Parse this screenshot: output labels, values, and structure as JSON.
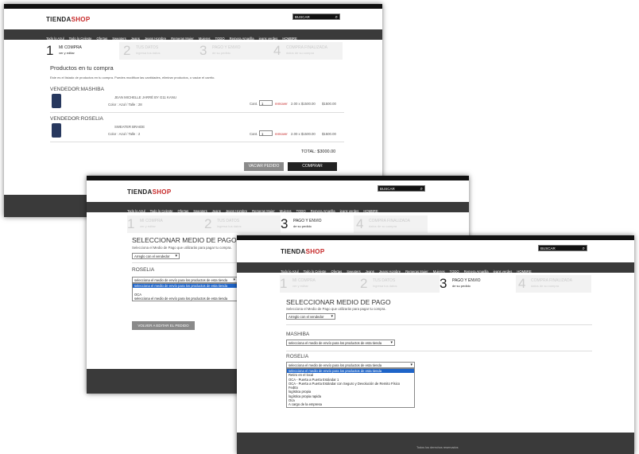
{
  "brand": {
    "name_a": "TIENDA",
    "name_b": "SHOP"
  },
  "search": {
    "label": "BUSCAR"
  },
  "nav": [
    "Todo lo Azul",
    "Todo lo Celeste",
    "Ofertas",
    "Sweaters",
    "Jeans",
    "Jeans Hombre",
    "Remeras Mujer",
    "Mujeres",
    "TODO",
    "Remera Amarilla",
    "jeans verdes",
    "HOMBRE"
  ],
  "steps": [
    {
      "num": "1",
      "title": "MI COMPRA",
      "sub": "ver y editar"
    },
    {
      "num": "2",
      "title": "TUS DATOS",
      "sub": "ingresa tus datos"
    },
    {
      "num": "3",
      "title": "PAGO Y ENVIO",
      "sub": "de su pedido"
    },
    {
      "num": "4",
      "title": "COMPRA FINALIZADA",
      "sub": "datos de su compra"
    }
  ],
  "cart": {
    "heading": "Productos en tu compra",
    "intro": "Este es el listado de productos en tu compra. Puedes modificar las cantidades, eliminar productos, o vaciar el carrito.",
    "vendors": [
      {
        "label": "VENDEDOR:MASHIBA",
        "product": "JEAN MICHELLE JARRÉ BY G11 KANU",
        "variant": "Color : Azul / Talle : 28",
        "qty_label": "Cant.",
        "qty": "1",
        "remove": "remover",
        "unit": "2.00 x $1500.00",
        "total": "$1500.00"
      },
      {
        "label": "VENDEDOR:ROSELIA",
        "product": "SWEATER BRAIDE",
        "variant": "Color : Azul / Talle : 2",
        "qty_label": "Cant.",
        "qty": "1",
        "remove": "remover",
        "unit": "2.00 x $1500.00",
        "total": "$1500.00"
      }
    ],
    "grand_total": "TOTAL: $3000.00",
    "empty_button": "VACIAR PEDIDO",
    "buy_button": "COMPRAR"
  },
  "payment": {
    "heading": "SELECCIONAR MEDIO DE PAGO",
    "instruction": "Selecciona el Medio de Pago que utilizarás para pagar tu compra.",
    "method": "Arreglo con el vendedor",
    "back_button": "VOLVER A EDITAR EL PEDIDO"
  },
  "shipping": {
    "mid_vendor": "ROSELIA",
    "placeholder": "selecciona el medio de envío para los productos de esta tienda",
    "mid_options": [
      "selecciona el medio de envío para los productos de esta tienda",
      "",
      "OCA",
      "selecciona el medio de envío para los productos de esta tienda"
    ],
    "front_vendor_a": "MASHIBA",
    "front_vendor_b": "ROSELIA",
    "front_options": [
      "selecciona el medio de envío para los productos de esta tienda",
      "Retiro en el local",
      "OCA - Puerta a Puerta Estándar 1",
      "OCA - Puerta a Puerta Estándar con Seguro y Devolución de Remito Físico",
      "FedEx",
      "logística propia",
      "logística propia rapida",
      "Oca",
      "A cargo de la empresa"
    ]
  },
  "footer_text": "Todos los derechos reservados"
}
